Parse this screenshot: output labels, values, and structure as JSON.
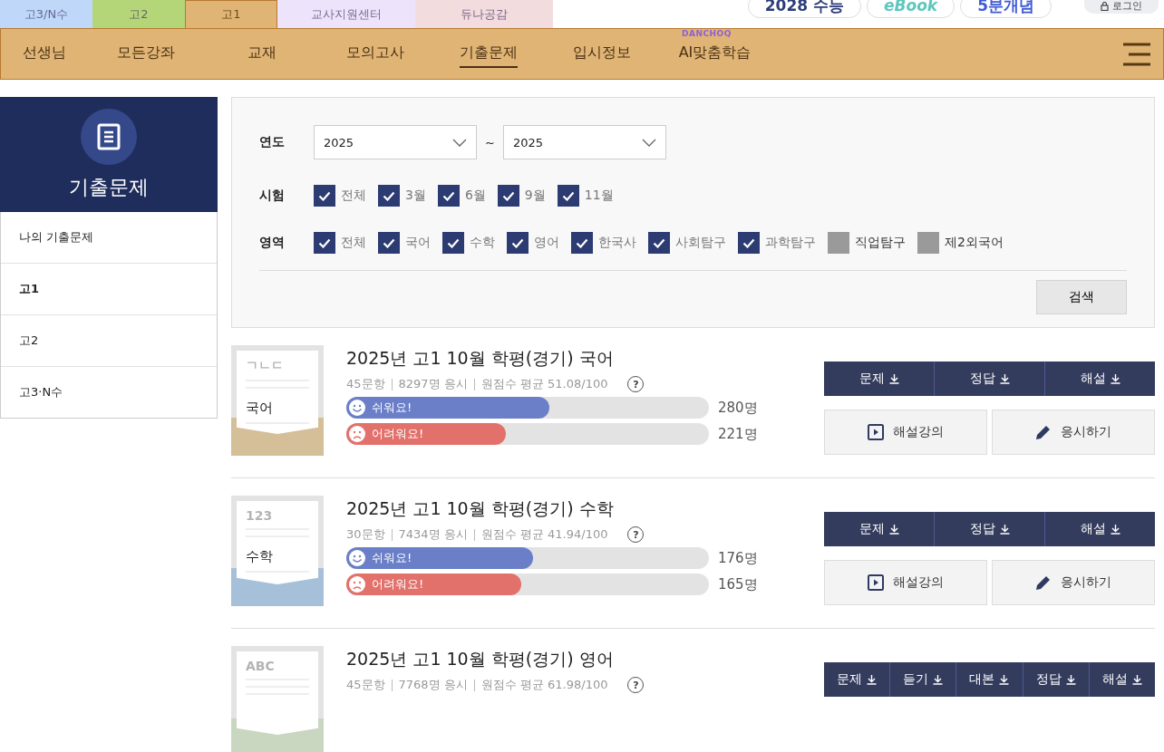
{
  "top_tabs": [
    {
      "label": "고3/N수",
      "selected": false,
      "color": "#bfd8fa"
    },
    {
      "label": "고2",
      "selected": false,
      "color": "#b5d678"
    },
    {
      "label": "고1",
      "selected": true,
      "color": "#e0b474"
    },
    {
      "label": "교사지원센터",
      "selected": false,
      "color": "#ede4fb"
    },
    {
      "label": "듀나공감",
      "selected": false,
      "color": "#f3dcdd"
    }
  ],
  "top_links": [
    {
      "label": "2028 수능",
      "kind": "pill"
    },
    {
      "label": "eBook",
      "kind": "logo"
    },
    {
      "label": "5분개념",
      "kind": "pill"
    },
    {
      "label": "로그인",
      "kind": "login"
    }
  ],
  "nav": [
    {
      "label": "선생님",
      "selected": false
    },
    {
      "label": "모든강좌",
      "selected": false
    },
    {
      "label": "교재",
      "selected": false
    },
    {
      "label": "모의고사",
      "selected": false
    },
    {
      "label": "기출문제",
      "selected": true
    },
    {
      "label": "입시정보",
      "selected": false
    },
    {
      "label": "AI맞춤학습",
      "selected": false,
      "badge": "DANCHOQ"
    }
  ],
  "sidebar": {
    "title": "기출문제",
    "items": [
      {
        "label": "나의 기출문제",
        "selected": false
      },
      {
        "label": "고1",
        "selected": true
      },
      {
        "label": "고2",
        "selected": false
      },
      {
        "label": "고3·N수",
        "selected": false
      }
    ]
  },
  "filters": {
    "year_label": "연도",
    "year_from": "2025",
    "year_sep": "~",
    "year_to": "2025",
    "exam_label": "시험",
    "exams": [
      {
        "label": "전체",
        "checked": true
      },
      {
        "label": "3월",
        "checked": true
      },
      {
        "label": "6월",
        "checked": true
      },
      {
        "label": "9월",
        "checked": true
      },
      {
        "label": "11월",
        "checked": true
      }
    ],
    "area_label": "영역",
    "areas": [
      {
        "label": "전체",
        "checked": true
      },
      {
        "label": "국어",
        "checked": true
      },
      {
        "label": "수학",
        "checked": true
      },
      {
        "label": "영어",
        "checked": true
      },
      {
        "label": "한국사",
        "checked": true
      },
      {
        "label": "사회탐구",
        "checked": true
      },
      {
        "label": "과학탐구",
        "checked": true
      },
      {
        "label": "직업탐구",
        "checked": false
      },
      {
        "label": "제2외국어",
        "checked": false
      }
    ],
    "search_button": "검색"
  },
  "exams": [
    {
      "title": "2025년 고1 10월 학평(경기) 국어",
      "meta": [
        "45문항",
        "8297명 응시",
        "원점수 평균 51.08/100"
      ],
      "help": "?",
      "thumb": {
        "label": "국어",
        "deco": "ㄱㄴㄷ",
        "color": "#d5bf98"
      },
      "votes": [
        {
          "kind": "easy",
          "label": "쉬워요!",
          "level": 0.56,
          "count": "280명"
        },
        {
          "kind": "hard",
          "label": "어려워요!",
          "level": 0.44,
          "count": "221명"
        }
      ],
      "downloads": [
        "문제",
        "정답",
        "해설"
      ],
      "actions": [
        {
          "kind": "video",
          "label": "해설강의"
        },
        {
          "kind": "take",
          "label": "응시하기"
        }
      ]
    },
    {
      "title": "2025년 고1 10월 학평(경기) 수학",
      "meta": [
        "30문항",
        "7434명 응시",
        "원점수 평균 41.94/100"
      ],
      "help": "?",
      "thumb": {
        "label": "수학",
        "deco": "123",
        "color": "#a7c0da"
      },
      "votes": [
        {
          "kind": "easy",
          "label": "쉬워요!",
          "level": 0.515,
          "count": "176명"
        },
        {
          "kind": "hard",
          "label": "어려워요!",
          "level": 0.482,
          "count": "165명"
        }
      ],
      "downloads": [
        "문제",
        "정답",
        "해설"
      ],
      "actions": [
        {
          "kind": "video",
          "label": "해설강의"
        },
        {
          "kind": "take",
          "label": "응시하기"
        }
      ]
    },
    {
      "title": "2025년 고1 10월 학평(경기) 영어",
      "meta": [
        "45문항",
        "7768명 응시",
        "원점수 평균 61.98/100"
      ],
      "help": "?",
      "thumb": {
        "deco": "ABC",
        "color": "#c9d6c0"
      },
      "downloads": [
        "문제",
        "듣기",
        "대본",
        "정답",
        "해설"
      ]
    }
  ]
}
